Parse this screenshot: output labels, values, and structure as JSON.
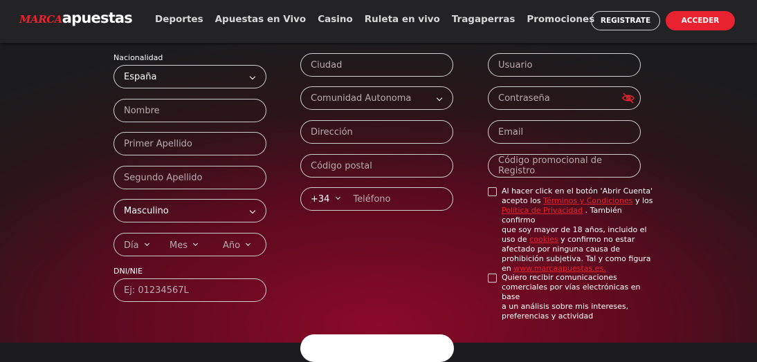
{
  "header": {
    "logo_marca": "MARCA",
    "logo_apuestas": "apuestas",
    "nav": [
      "Deportes",
      "Apuestas en Vivo",
      "Casino",
      "Ruleta en vivo",
      "Tragaperras",
      "Promociones"
    ],
    "register_label": "REGISTRATE",
    "login_label": "ACCEDER"
  },
  "form": {
    "nationality_label": "Nacionalidad",
    "nationality_value": "España",
    "name_placeholder": "Nombre",
    "first_surname_placeholder": "Primer Apellido",
    "second_surname_placeholder": "Segundo Apellido",
    "gender_value": "Masculino",
    "day_placeholder": "Día",
    "month_placeholder": "Mes",
    "year_placeholder": "Año",
    "dni_label": "DNI/NIE",
    "dni_placeholder": "Ej: 01234567L",
    "city_placeholder": "Ciudad",
    "community_placeholder": "Comunidad Autonoma",
    "address_placeholder": "Dirección",
    "postal_placeholder": "Código postal",
    "phone_prefix": "+34",
    "phone_placeholder": "Teléfono",
    "username_placeholder": "Usuario",
    "password_placeholder": "Contraseña",
    "email_placeholder": "Email",
    "promo_placeholder": "Código promocional de Registro"
  },
  "legal": {
    "terms_line1": "Al hacer click en el botón 'Abrir Cuenta'",
    "terms_line2_a": "acepto los ",
    "terms_link": "Términos y Condiciones",
    "terms_line2_b": " y los",
    "privacy_link": "Política de Privacidad",
    "terms_line3_b": " . También confirmo",
    "terms_line4": "que soy mayor de 18 años, incluido el",
    "terms_line5_a": "uso de ",
    "cookies_link": "cookies",
    "terms_line5_b": " y confirmo no estar",
    "terms_line6": "afectado por ninguna causa de",
    "terms_line7": "prohibición subjetiva. Tal y como figura",
    "terms_line8_a": "en ",
    "site_link": "www.marcaapuestas.es.",
    "marketing_line1": "Quiero recibir comunicaciones",
    "marketing_line2": "comerciales por vías electrónicas en base",
    "marketing_line3": "a un análisis sobre mis intereses,",
    "marketing_line4": "preferencias y actividad"
  },
  "colors": {
    "accent": "#e8232f",
    "header_bg": "#232325",
    "bg_dark": "#1c1c1e",
    "bg_red": "#8a0a28"
  }
}
